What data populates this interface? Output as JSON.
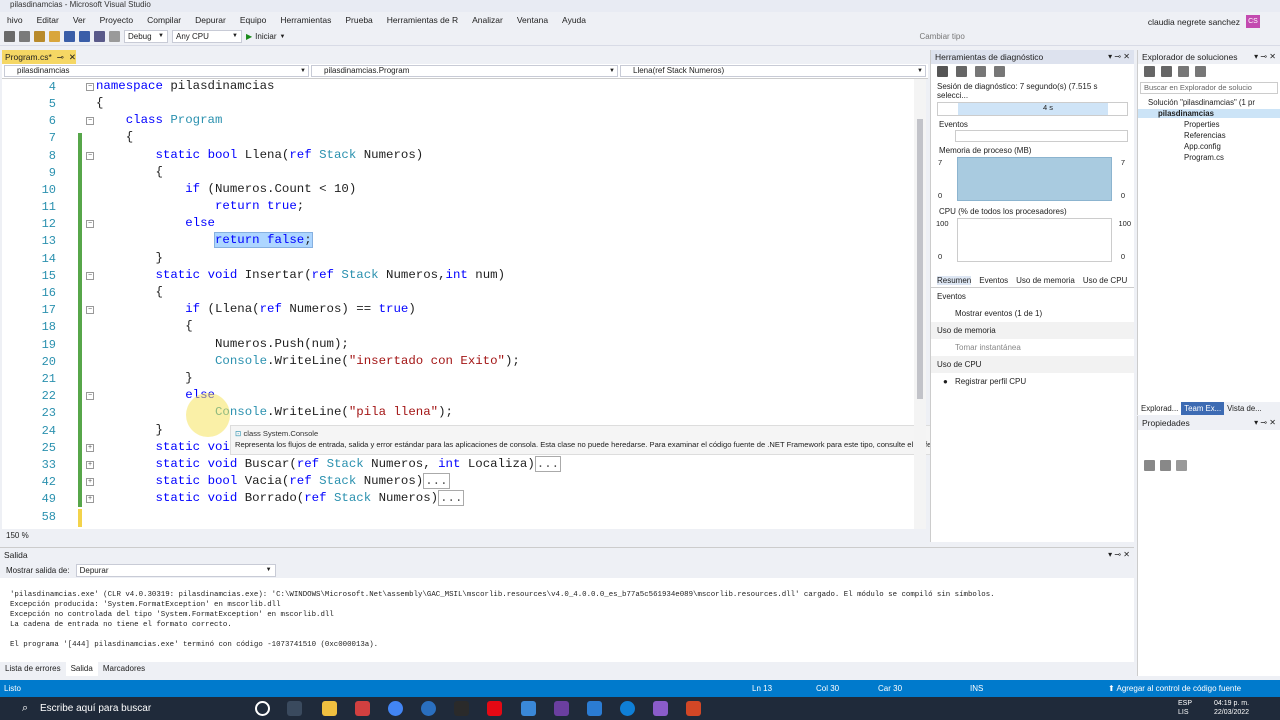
{
  "window": {
    "title": "pilasdinamcias - Microsoft Visual Studio",
    "user": "claudia negrete sanchez",
    "user_initials": "CS"
  },
  "menu": [
    "hivo",
    "Editar",
    "Ver",
    "Proyecto",
    "Compilar",
    "Depurar",
    "Equipo",
    "Herramientas",
    "Prueba",
    "Herramientas de R",
    "Analizar",
    "Ventana",
    "Ayuda"
  ],
  "toolbar": {
    "config": "Debug",
    "platform": "Any CPU",
    "start": "Iniciar",
    "cambiar_tipo": "Cambiar tipo"
  },
  "editor": {
    "tab": "Program.cs*",
    "nav": {
      "project": "pilasdinamcias",
      "class": "pilasdinamcias.Program",
      "member": "Llena(ref Stack Numeros)"
    },
    "zoom": "150 %",
    "line_numbers": [
      "4",
      "5",
      "6",
      "7",
      "8",
      "9",
      "10",
      "11",
      "12",
      "13",
      "14",
      "15",
      "16",
      "17",
      "18",
      "19",
      "20",
      "21",
      "22",
      "23",
      "24",
      "25",
      "33",
      "42",
      "49",
      "58"
    ],
    "tooltip": {
      "header": "class System.Console",
      "body": "Representa los flujos de entrada, salida y error estándar para las aplicaciones de consola. Esta clase no puede heredarse. Para examinar el código fuente de .NET Framework para este tipo, consulte el Reference Source."
    }
  },
  "diagnostics": {
    "title": "Herramientas de diagnóstico",
    "session": "Sesión de diagnóstico: 7 segundo(s) (7.515 s selecci...",
    "timeline_label": "4 s",
    "eventos": "Eventos",
    "memoria": "Memoria de proceso (MB)",
    "mem_max": "7",
    "mem_min": "0",
    "cpu": "CPU (% de todos los procesadores)",
    "cpu_max": "100",
    "cpu_min": "0",
    "tabs": [
      "Resumen",
      "Eventos",
      "Uso de memoria",
      "Uso de CPU"
    ],
    "sections": [
      {
        "h": "Eventos",
        "item": "Mostrar eventos (1 de 1)"
      },
      {
        "h": "Uso de memoria",
        "item": "Tomar instantánea"
      },
      {
        "h": "Uso de CPU",
        "item": "Registrar perfil CPU"
      }
    ]
  },
  "solution": {
    "title": "Explorador de soluciones",
    "search": "Buscar en Explorador de solucio",
    "items": [
      "Solución \"pilasdinamcias\" (1 pr",
      "pilasdinamcias",
      "Properties",
      "Referencias",
      "App.config",
      "Program.cs"
    ],
    "tabs": [
      "Explorad...",
      "Team Ex...",
      "Vista de..."
    ]
  },
  "properties": {
    "title": "Propiedades"
  },
  "output": {
    "title": "Salida",
    "show_from_label": "Mostrar salida de:",
    "show_from": "Depurar",
    "lines": [
      "'pilasdinamcias.exe' (CLR v4.0.30319: pilasdinamcias.exe): 'C:\\WINDOWS\\Microsoft.Net\\assembly\\GAC_MSIL\\mscorlib.resources\\v4.0_4.0.0.0_es_b77a5c561934e089\\mscorlib.resources.dll' cargado. El módulo se compiló sin símbolos.",
      "Excepción producida: 'System.FormatException' en mscorlib.dll",
      "Excepción no controlada del tipo 'System.FormatException' en mscorlib.dll",
      "La cadena de entrada no tiene el formato correcto.",
      "",
      "El programa '[444] pilasdinamcias.exe' terminó con código -1073741510 (0xc000013a)."
    ],
    "tabs": [
      "Lista de errores",
      "Salida",
      "Marcadores"
    ]
  },
  "status": {
    "ready": "Listo",
    "ln": "Ln 13",
    "col": "Col 30",
    "car": "Car 30",
    "ins": "INS",
    "source": "Agregar al control de código fuente"
  },
  "taskbar": {
    "search": "Escribe aquí para buscar",
    "lang": "ESP",
    "lang2": "LIS",
    "time": "04:19 p. m.",
    "date": "22/03/2022"
  }
}
